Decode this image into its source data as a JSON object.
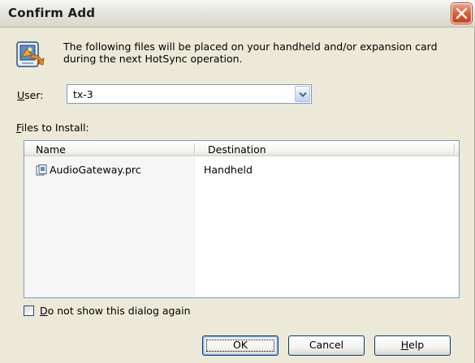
{
  "window": {
    "title": "Confirm Add"
  },
  "message": {
    "text": "The following files will be placed on your handheld and/or expansion card during the next HotSync operation."
  },
  "user": {
    "label_accel": "U",
    "label_rest": "ser:",
    "value": "tx-3"
  },
  "files": {
    "label_accel": "F",
    "label_rest": "iles to Install:",
    "columns": [
      "Name",
      "Destination"
    ],
    "rows": [
      {
        "name": "AudioGateway.prc",
        "destination": "Handheld"
      }
    ]
  },
  "checkbox": {
    "label_accel": "D",
    "label_rest": "o not show this dialog again",
    "checked": false
  },
  "buttons": {
    "ok": "OK",
    "cancel": "Cancel",
    "help_accel": "H",
    "help_rest": "elp"
  },
  "icons": {
    "close": "close-icon",
    "message": "hotsync-install-icon",
    "dropdown": "chevron-down-icon",
    "file": "prc-file-icon"
  },
  "colors": {
    "close_button": "#d9603c",
    "border": "#7f9db9",
    "button_border": "#003c74"
  }
}
